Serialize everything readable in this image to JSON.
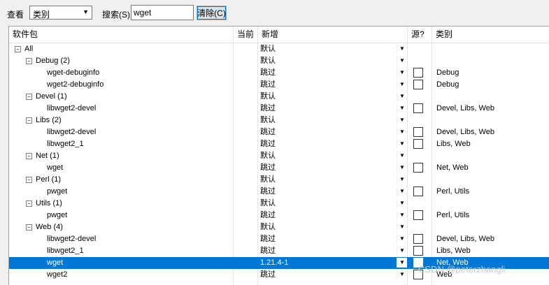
{
  "toolbar": {
    "view_label": "查看",
    "view_value": "类别",
    "search_label": "搜索(S)",
    "search_value": "wget",
    "clear_label": "清除(C)"
  },
  "columns": {
    "package": "软件包",
    "current": "当前",
    "new": "新增",
    "source": "源?",
    "category": "类别"
  },
  "rows": [
    {
      "level": 0,
      "toggle": "⊟",
      "label": "All",
      "new": "默认",
      "has_dd": true,
      "check": false,
      "category": ""
    },
    {
      "level": 1,
      "toggle": "⊟",
      "label": "Debug (2)",
      "new": "默认",
      "has_dd": true,
      "check": false,
      "category": ""
    },
    {
      "level": 2,
      "toggle": "",
      "label": "wget-debuginfo",
      "new": "跳过",
      "has_dd": true,
      "check": true,
      "category": "Debug"
    },
    {
      "level": 2,
      "toggle": "",
      "label": "wget2-debuginfo",
      "new": "跳过",
      "has_dd": true,
      "check": true,
      "category": "Debug"
    },
    {
      "level": 1,
      "toggle": "⊟",
      "label": "Devel (1)",
      "new": "默认",
      "has_dd": true,
      "check": false,
      "category": ""
    },
    {
      "level": 2,
      "toggle": "",
      "label": "libwget2-devel",
      "new": "跳过",
      "has_dd": true,
      "check": true,
      "category": "Devel, Libs, Web"
    },
    {
      "level": 1,
      "toggle": "⊟",
      "label": "Libs (2)",
      "new": "默认",
      "has_dd": true,
      "check": false,
      "category": ""
    },
    {
      "level": 2,
      "toggle": "",
      "label": "libwget2-devel",
      "new": "跳过",
      "has_dd": true,
      "check": true,
      "category": "Devel, Libs, Web"
    },
    {
      "level": 2,
      "toggle": "",
      "label": "libwget2_1",
      "new": "跳过",
      "has_dd": true,
      "check": true,
      "category": "Libs, Web"
    },
    {
      "level": 1,
      "toggle": "⊟",
      "label": "Net (1)",
      "new": "默认",
      "has_dd": true,
      "check": false,
      "category": ""
    },
    {
      "level": 2,
      "toggle": "",
      "label": "wget",
      "new": "跳过",
      "has_dd": true,
      "check": true,
      "category": "Net, Web"
    },
    {
      "level": 1,
      "toggle": "⊟",
      "label": "Perl (1)",
      "new": "默认",
      "has_dd": true,
      "check": false,
      "category": ""
    },
    {
      "level": 2,
      "toggle": "",
      "label": "pwget",
      "new": "跳过",
      "has_dd": true,
      "check": true,
      "category": "Perl, Utils"
    },
    {
      "level": 1,
      "toggle": "⊟",
      "label": "Utils (1)",
      "new": "默认",
      "has_dd": true,
      "check": false,
      "category": ""
    },
    {
      "level": 2,
      "toggle": "",
      "label": "pwget",
      "new": "跳过",
      "has_dd": true,
      "check": true,
      "category": "Perl, Utils"
    },
    {
      "level": 1,
      "toggle": "⊟",
      "label": "Web (4)",
      "new": "默认",
      "has_dd": true,
      "check": false,
      "category": ""
    },
    {
      "level": 2,
      "toggle": "",
      "label": "libwget2-devel",
      "new": "跳过",
      "has_dd": true,
      "check": true,
      "category": "Devel, Libs, Web"
    },
    {
      "level": 2,
      "toggle": "",
      "label": "libwget2_1",
      "new": "跳过",
      "has_dd": true,
      "check": true,
      "category": "Libs, Web"
    },
    {
      "level": 2,
      "toggle": "",
      "label": "wget",
      "new": "1.21.4-1",
      "has_dd": true,
      "check": true,
      "category": "Net, Web",
      "selected": true
    },
    {
      "level": 2,
      "toggle": "",
      "label": "wget2",
      "new": "跳过",
      "has_dd": true,
      "check": true,
      "category": "Web"
    }
  ],
  "watermark": "CSDN @peterzhangli",
  "colors": {
    "selection": "#0078d7"
  }
}
